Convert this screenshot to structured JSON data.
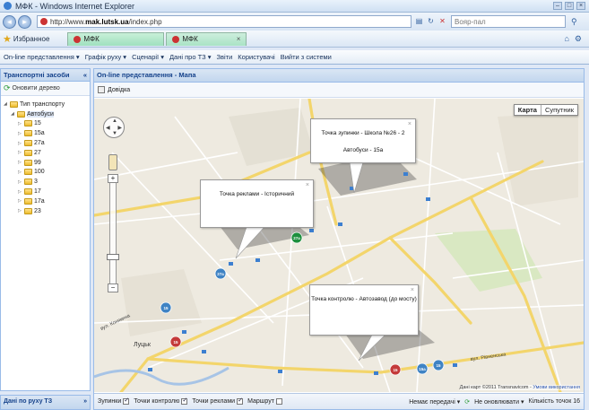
{
  "window": {
    "title": "МФК - Windows Internet Explorer"
  },
  "address": {
    "url_prefix": "http://www.",
    "url_host": "mak.lutsk.ua",
    "url_path": "/index.php",
    "search_placeholder": "Вояр-пал"
  },
  "favorites": {
    "label": "Избранное",
    "tabs": [
      {
        "label": "МФК"
      },
      {
        "label": "МФК"
      }
    ]
  },
  "menu": {
    "items": [
      {
        "label": "On-line представлення ▾"
      },
      {
        "label": "Графік руху ▾"
      },
      {
        "label": "Сценарії ▾"
      },
      {
        "label": "Дані про ТЗ ▾"
      },
      {
        "label": "Звіти"
      },
      {
        "label": "Користувачі"
      },
      {
        "label": "Вийти з системи"
      }
    ]
  },
  "sidebar": {
    "title": "Транспортні засоби",
    "refresh_label": "Оновити дерево",
    "tree": {
      "root": "Тип транспорту",
      "group": "Автобуси",
      "routes": [
        "15",
        "15а",
        "27а",
        "27",
        "99",
        "100",
        "3",
        "17",
        "17а",
        "23"
      ]
    },
    "bottom_title": "Дані по руху ТЗ"
  },
  "main": {
    "title": "On-line представлення - Мапа",
    "help_label": "Довідка",
    "map_type": {
      "map": "Карта",
      "satellite": "Супутник"
    },
    "bubbles": [
      {
        "line1": "Точка зупинки - Школа №26 - 2",
        "line2": "Автобуси - 15а"
      },
      {
        "line1": "Точка реклами - Історичний",
        "line2": ""
      },
      {
        "line1": "Точка контролю - Автозавод (до мосту)",
        "line2": ""
      }
    ],
    "copyright": "Дані карт ©2011 Transnavicom - ",
    "terms": "Умови використання",
    "street_labels": [
      "вул. Конякина",
      "вул. Рівненська",
      "Луцьк"
    ],
    "markers": [
      {
        "label": "27а",
        "color": "#1d8f3e"
      },
      {
        "label": "27а",
        "color": "#3f83c4"
      },
      {
        "label": "15",
        "color": "#3f83c4"
      },
      {
        "label": "15",
        "color": "#c43a3a"
      },
      {
        "label": "15",
        "color": "#c43a3a"
      },
      {
        "label": "15а",
        "color": "#3f83c4"
      },
      {
        "label": "15",
        "color": "#3f83c4"
      }
    ]
  },
  "status": {
    "stops": "Зупинки",
    "control": "Точки контролю",
    "ads": "Точки реклами",
    "route": "Маршрут",
    "no_transfer": "Немає передачі ▾",
    "not_update": "Не оновлювати ▾",
    "count": "Кількість точок 16"
  },
  "colors": {
    "accent": "#15428b",
    "panel_border": "#99bbe8"
  }
}
